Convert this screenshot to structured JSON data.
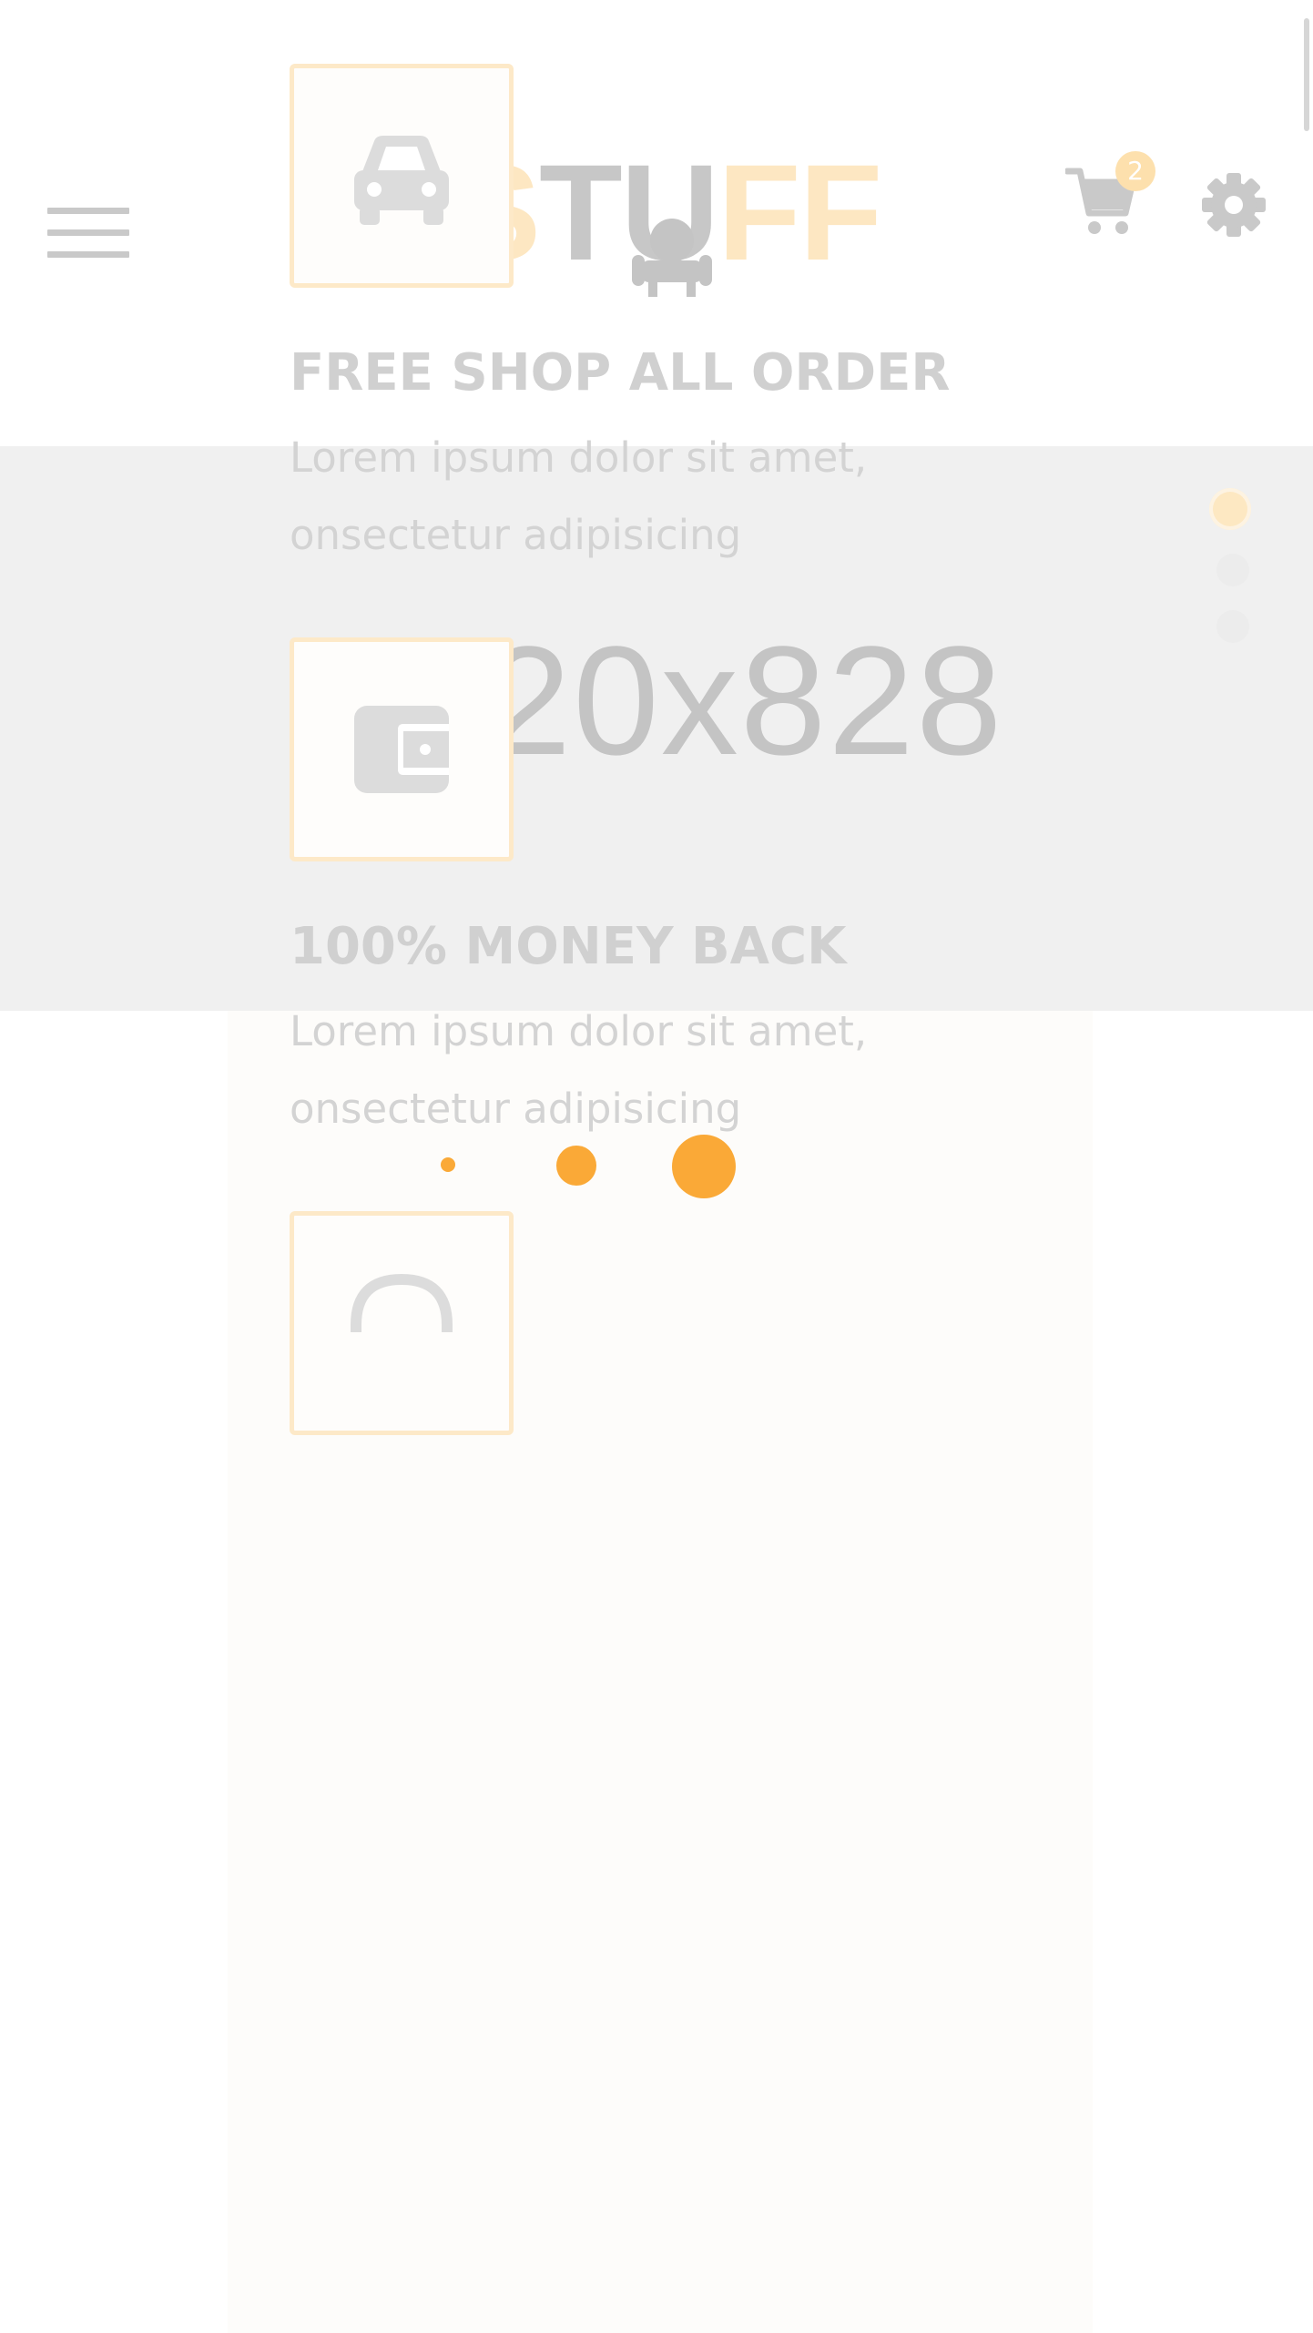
{
  "header": {
    "menu_icon": "hamburger-menu-icon",
    "logo": {
      "text": "STUFF",
      "icon": "armchair-icon"
    },
    "cart": {
      "icon": "shopping-cart-icon",
      "count": "2"
    },
    "settings_icon": "gear-icon"
  },
  "banner": {
    "placeholder_text": "1820x828",
    "slides": [
      {
        "active": true
      },
      {
        "active": false
      },
      {
        "active": false
      }
    ]
  },
  "features": [
    {
      "icon": "car-icon",
      "title": "FREE SHOP ALL ORDER",
      "description": "Lorem ipsum dolor sit amet, onsectetur adipisicing"
    },
    {
      "icon": "wallet-icon",
      "title": "100% MONEY BACK",
      "description": "Lorem ipsum dolor sit amet, onsectetur adipisicing"
    },
    {
      "icon": "headset-icon",
      "title": "",
      "description": ""
    }
  ],
  "loader": {
    "dots": 3
  },
  "colors": {
    "accent": "#faa937",
    "accent_light": "#fde9c8",
    "icon_gray": "#c9c9c9",
    "text_gray": "#d0d0d0",
    "banner_bg": "#f0f0f0"
  }
}
